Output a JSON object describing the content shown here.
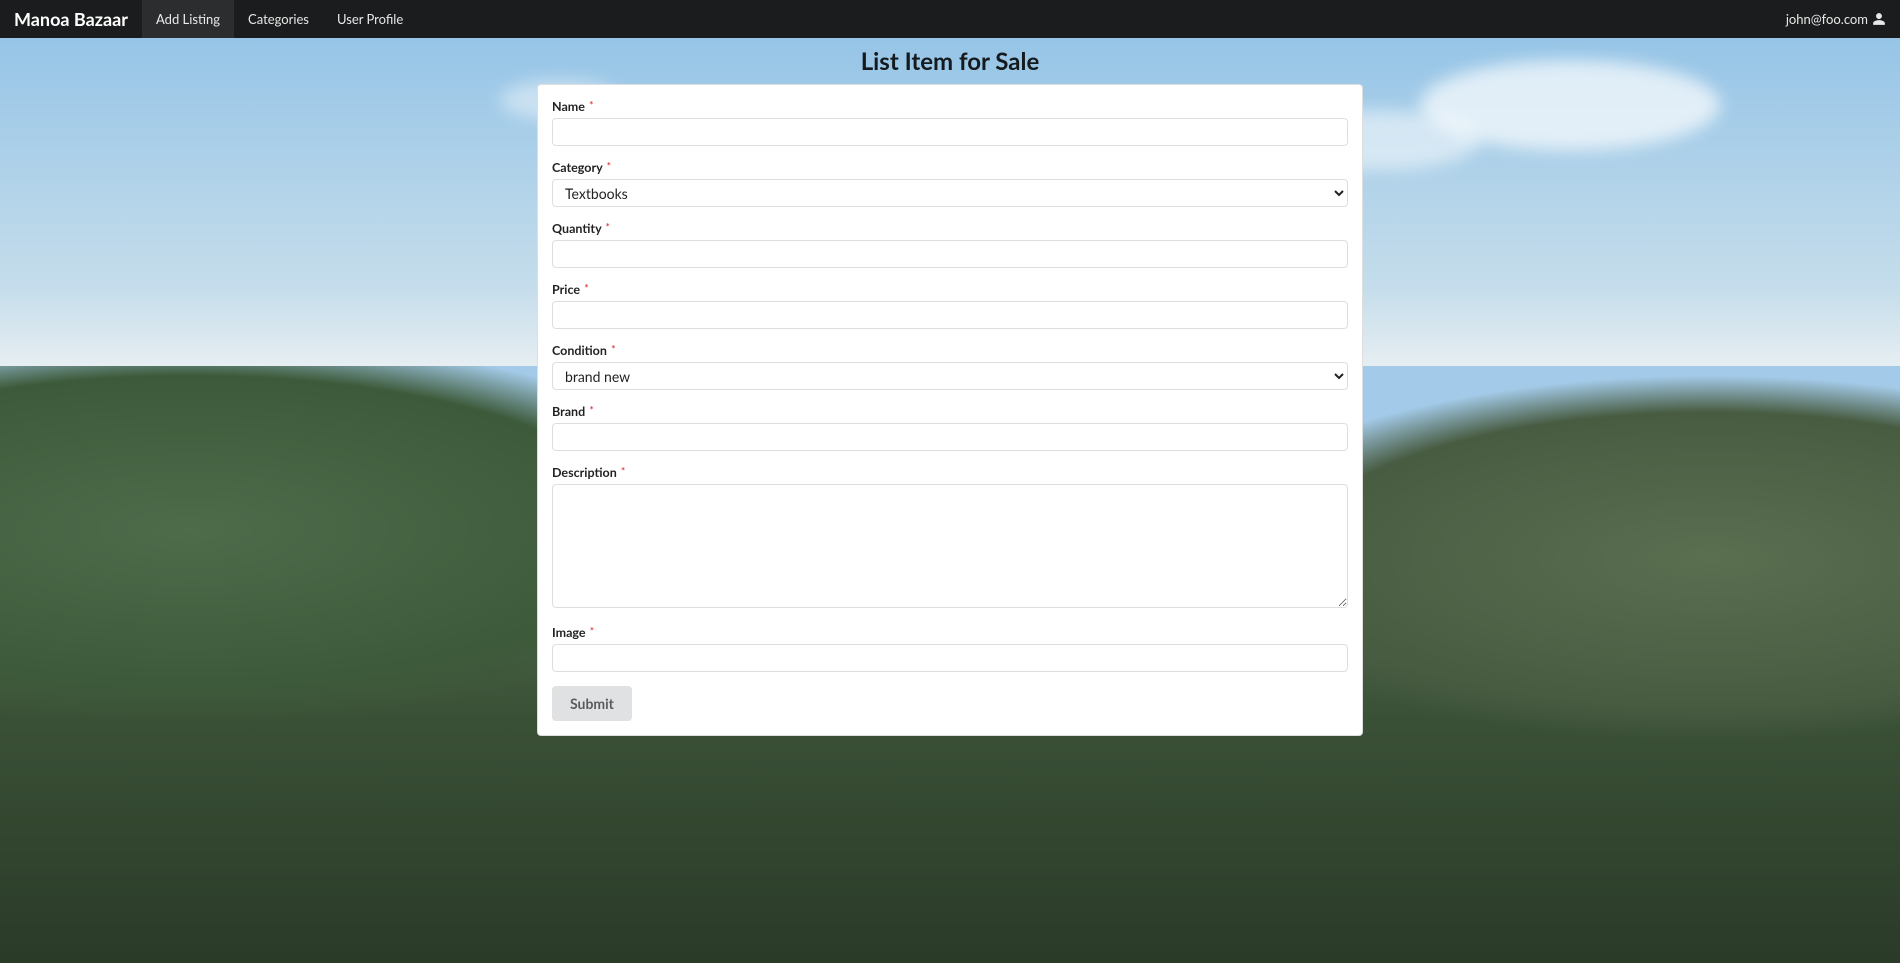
{
  "navbar": {
    "brand": "Manoa Bazaar",
    "items": [
      {
        "label": "Add Listing",
        "active": true
      },
      {
        "label": "Categories",
        "active": false
      },
      {
        "label": "User Profile",
        "active": false
      }
    ],
    "user": "john@foo.com"
  },
  "page": {
    "title": "List Item for Sale"
  },
  "form": {
    "fields": {
      "name": {
        "label": "Name",
        "value": ""
      },
      "category": {
        "label": "Category",
        "value": "Textbooks",
        "options": [
          "Textbooks"
        ]
      },
      "quantity": {
        "label": "Quantity",
        "value": ""
      },
      "price": {
        "label": "Price",
        "value": ""
      },
      "condition": {
        "label": "Condition",
        "value": "brand new",
        "options": [
          "brand new"
        ]
      },
      "brand": {
        "label": "Brand",
        "value": ""
      },
      "description": {
        "label": "Description",
        "value": ""
      },
      "image": {
        "label": "Image",
        "value": ""
      }
    },
    "submit_label": "Submit",
    "required_marker": "*"
  }
}
